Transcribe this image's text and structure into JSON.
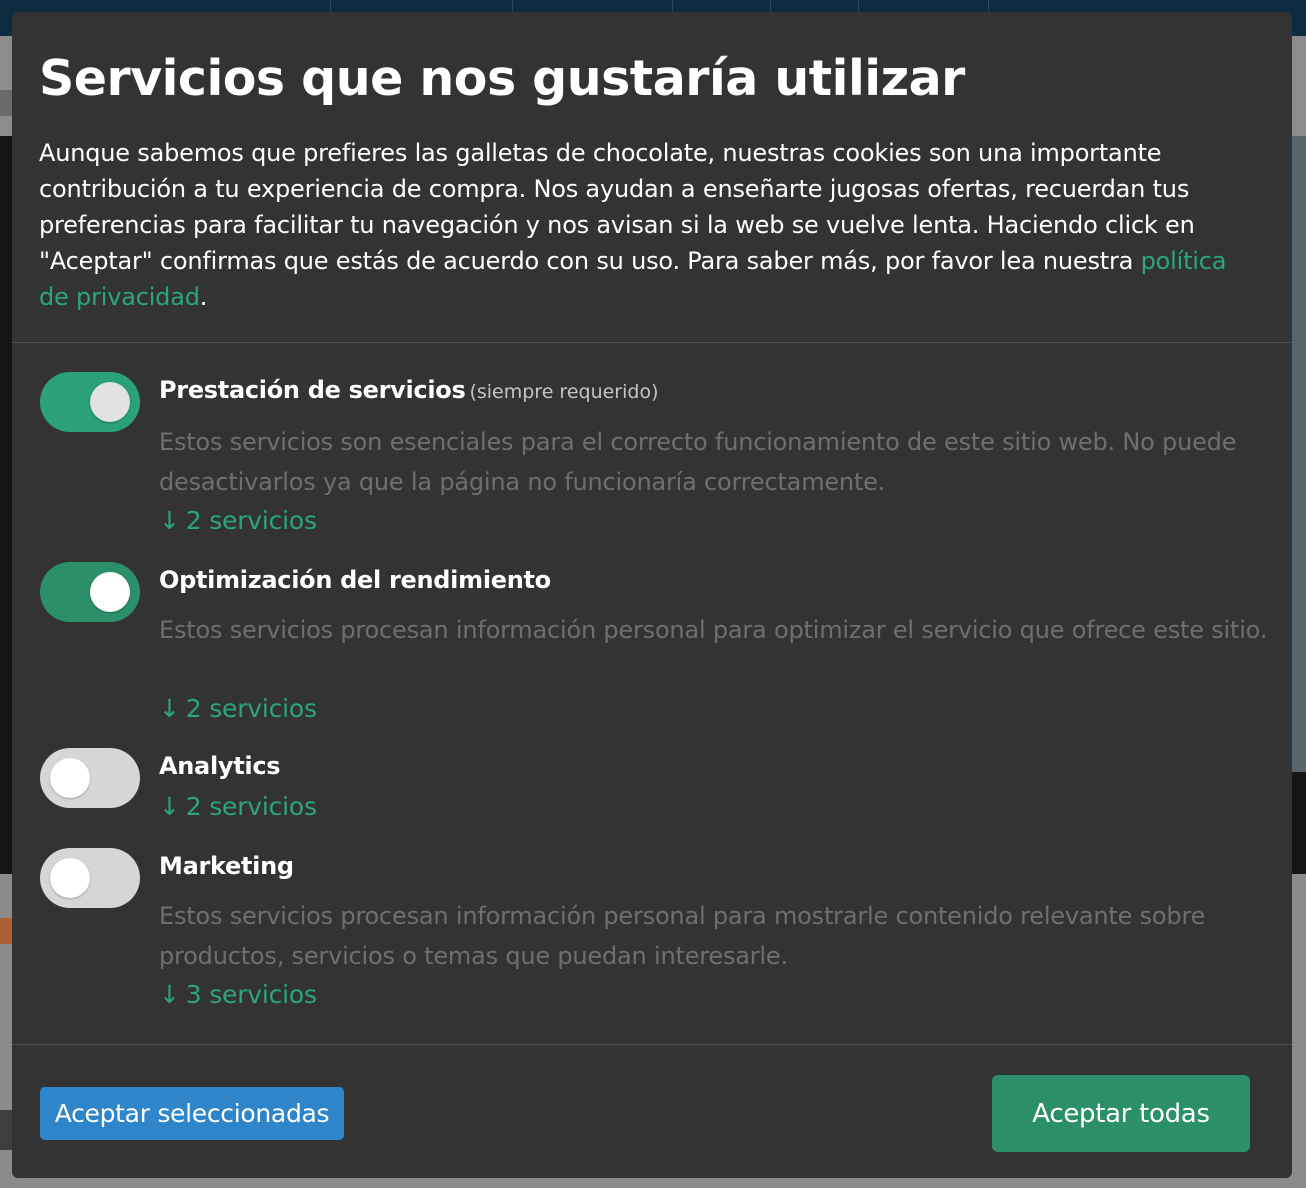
{
  "colors": {
    "accent_green": "#2ba67c",
    "toggle_on": "#2b8f6a",
    "toggle_off": "#d6d6d6",
    "modal_bg": "#333333",
    "button_blue": "#2f85c9"
  },
  "modal": {
    "title": "Servicios que nos gustaría utilizar",
    "description_text": "Aunque sabemos que prefieres las galletas de chocolate, nuestras cookies son una importante contribución a tu experiencia de compra. Nos ayudan a enseñarte jugosas ofertas, recuerdan tus preferencias para facilitar tu navegación y nos avisan si la web se vuelve lenta. Haciendo click en \"Aceptar\" confirmas que estás de acuerdo con su uso. Para saber más, por favor lea nuestra ",
    "privacy_link": "política de privacidad",
    "description_end": "."
  },
  "purposes": [
    {
      "title": "Prestación de servicios",
      "required_note": "(siempre requerido)",
      "enabled": true,
      "description": "Estos servicios son esenciales para el correcto funcionamiento de este sitio web. No puede desactivarlos ya que la página no funcionaría correctamente.",
      "services_link": "2 servicios"
    },
    {
      "title": "Optimización del rendimiento",
      "enabled": true,
      "description": "Estos servicios procesan información personal para optimizar el servicio que ofrece este sitio.",
      "services_link": "2 servicios"
    },
    {
      "title": "Analytics",
      "enabled": false,
      "services_link": "2 servicios"
    },
    {
      "title": "Marketing",
      "enabled": false,
      "description": "Estos servicios procesan información personal para mostrarle contenido relevante sobre productos, servicios o temas que puedan interesarle.",
      "services_link": "3 servicios"
    }
  ],
  "icons": {
    "expand_arrow": "↓"
  },
  "buttons": {
    "accept_selected": "Aceptar seleccionadas",
    "accept_all": "Aceptar todas"
  }
}
